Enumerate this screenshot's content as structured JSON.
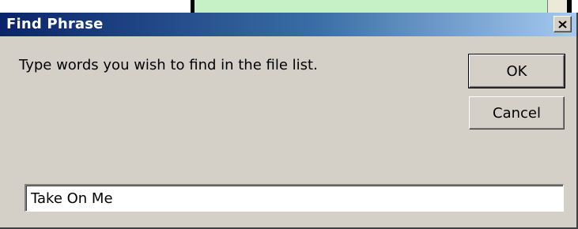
{
  "dialog": {
    "title": "Find Phrase",
    "prompt": "Type words you wish to find in the file list.",
    "ok_label": "OK",
    "cancel_label": "Cancel",
    "search_value": "Take On Me"
  },
  "colors": {
    "title_bar_start": "#0a246a",
    "title_bar_end": "#a6caf0",
    "dialog_face": "#d4d0c8",
    "background_panel": "#c6f0c6"
  },
  "icons": {
    "close": "close-icon"
  }
}
